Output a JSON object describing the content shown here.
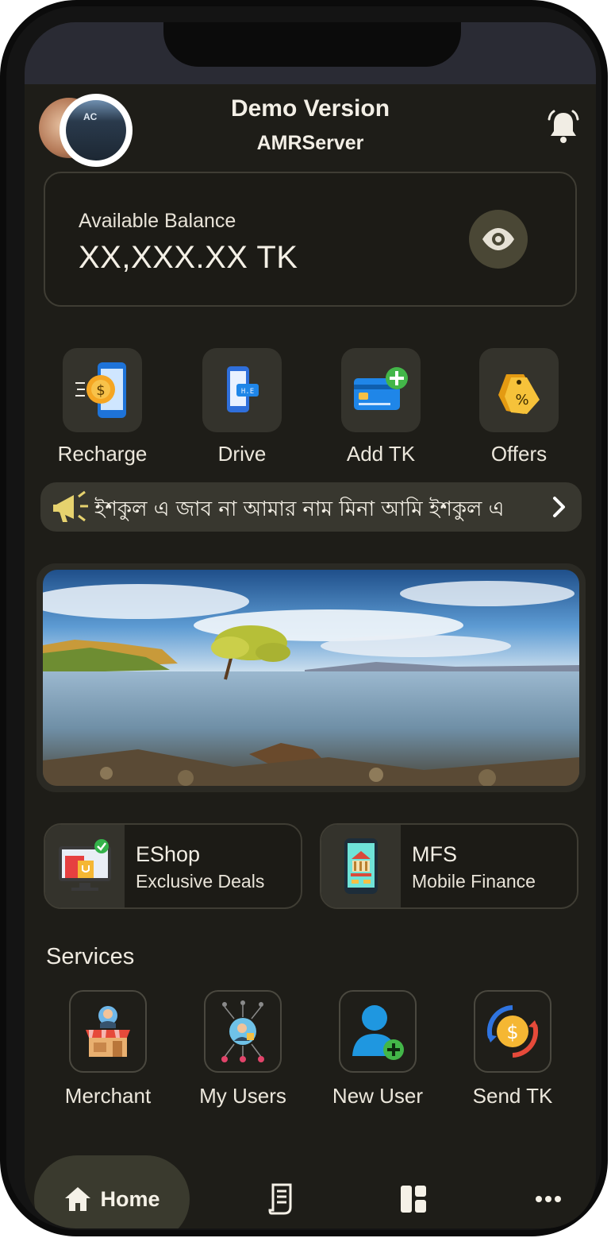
{
  "header": {
    "title": "Demo Version",
    "subtitle": "AMRServer",
    "avatar_label": "AC"
  },
  "balance": {
    "label": "Available Balance",
    "value": "XX,XXX.XX TK"
  },
  "quick_actions": [
    {
      "label": "Recharge",
      "icon": "recharge-icon"
    },
    {
      "label": "Drive",
      "icon": "drive-icon"
    },
    {
      "label": "Add TK",
      "icon": "add-tk-icon"
    },
    {
      "label": "Offers",
      "icon": "offers-icon"
    }
  ],
  "notice": {
    "text": "ইশকুল এ  জাব না    আমার নাম মিনা আমি ইশকুল এ"
  },
  "features": [
    {
      "title": "EShop",
      "subtitle": "Exclusive Deals",
      "icon": "eshop-icon"
    },
    {
      "title": "MFS",
      "subtitle": "Mobile Finance",
      "icon": "mfs-icon"
    }
  ],
  "services": {
    "title": "Services",
    "items": [
      {
        "label": "Merchant",
        "icon": "merchant-icon"
      },
      {
        "label": "My Users",
        "icon": "my-users-icon"
      },
      {
        "label": "New User",
        "icon": "new-user-icon"
      },
      {
        "label": "Send TK",
        "icon": "send-tk-icon"
      }
    ]
  },
  "bottom_nav": {
    "home_label": "Home",
    "items": [
      "home-icon",
      "receipt-icon",
      "dashboard-icon",
      "more-icon"
    ]
  },
  "colors": {
    "background": "#1e1d18",
    "card_border": "#3f3d34",
    "tile": "#34332c",
    "accent_eye": "#4a4735"
  }
}
